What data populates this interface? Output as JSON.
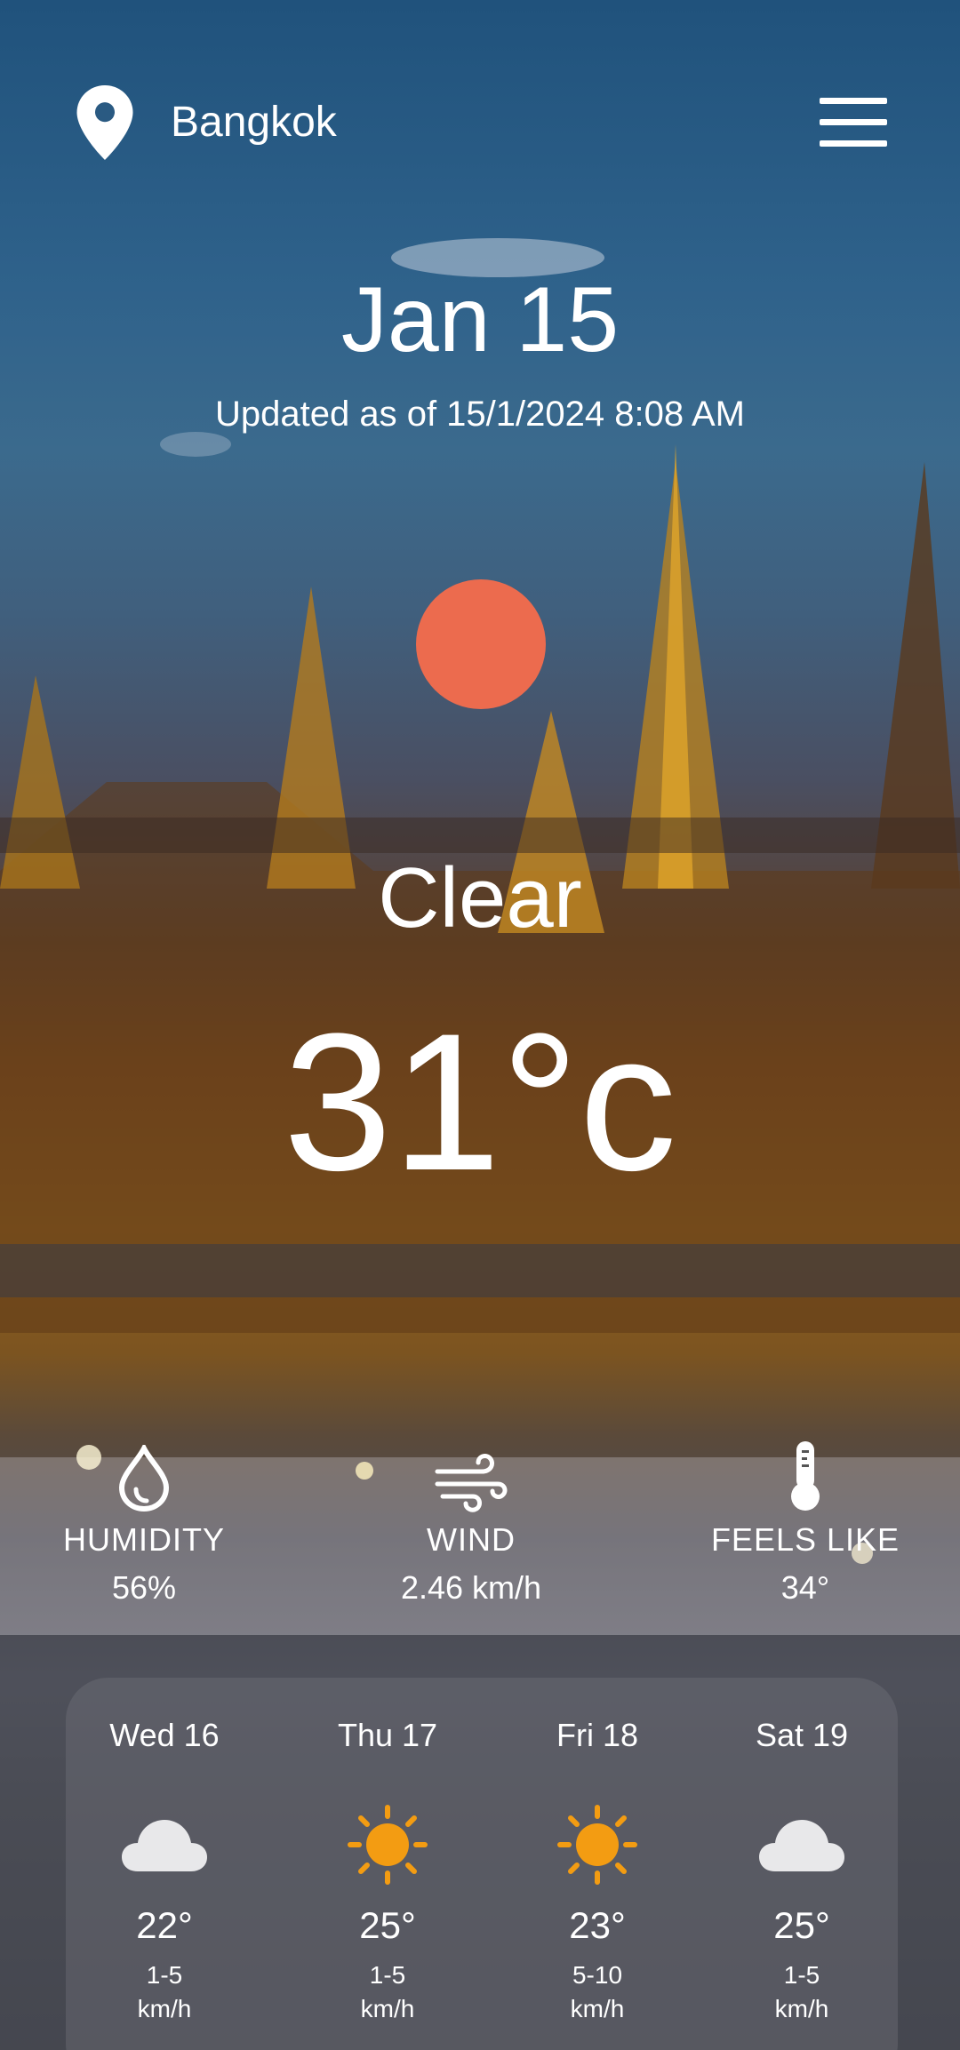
{
  "header": {
    "city": "Bangkok",
    "location_icon": "location-pin-icon",
    "menu_icon": "hamburger-menu-icon"
  },
  "current": {
    "date": "Jan 15",
    "updated": "Updated as of 15/1/2024 8:08 AM",
    "condition": "Clear",
    "temperature": "31°c",
    "condition_icon": "sun-icon",
    "sun_color": "#ec6b4e"
  },
  "stats": [
    {
      "label": "HUMIDITY",
      "value": "56%",
      "icon": "droplet-icon"
    },
    {
      "label": "WIND",
      "value": "2.46 km/h",
      "icon": "wind-icon"
    },
    {
      "label": "FEELS LIKE",
      "value": "34°",
      "icon": "thermometer-icon"
    }
  ],
  "forecast": [
    {
      "day": "Wed 16",
      "temp": "22°",
      "wind": "1-5",
      "unit": "km/h",
      "icon": "cloud-icon"
    },
    {
      "day": "Thu 17",
      "temp": "25°",
      "wind": "1-5",
      "unit": "km/h",
      "icon": "sun-icon"
    },
    {
      "day": "Fri 18",
      "temp": "23°",
      "wind": "5-10",
      "unit": "km/h",
      "icon": "sun-icon"
    },
    {
      "day": "Sat 19",
      "temp": "25°",
      "wind": "1-5",
      "unit": "km/h",
      "icon": "cloud-icon"
    }
  ],
  "colors": {
    "accent_sun": "#f39c12",
    "cloud": "#e8e8ea",
    "text": "#ffffff"
  }
}
